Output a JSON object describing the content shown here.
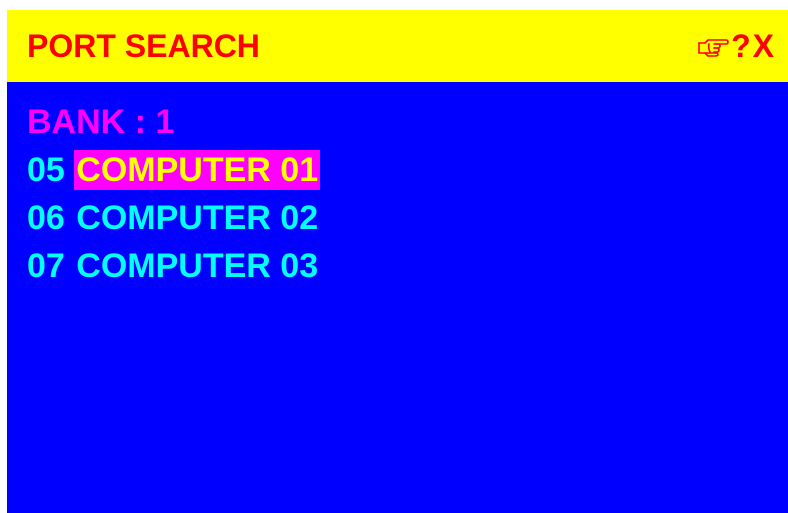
{
  "window": {
    "title": "PORT SEARCH",
    "help_label": "?",
    "close_label": "X",
    "hand_icon": "pointing-hand-icon"
  },
  "bank": {
    "label": "BANK : 1"
  },
  "ports": [
    {
      "number": "05",
      "name": "COMPUTER 01",
      "selected": true
    },
    {
      "number": "06",
      "name": "COMPUTER 02",
      "selected": false
    },
    {
      "number": "07",
      "name": "COMPUTER 03",
      "selected": false
    }
  ],
  "colors": {
    "background": "#0000ff",
    "title_bar": "#ffff00",
    "title_text": "#ff0000",
    "bank_text": "#ff00ff",
    "port_text": "#00ffff",
    "selection_bg": "#ff00ff",
    "selection_text": "#ffff00"
  }
}
